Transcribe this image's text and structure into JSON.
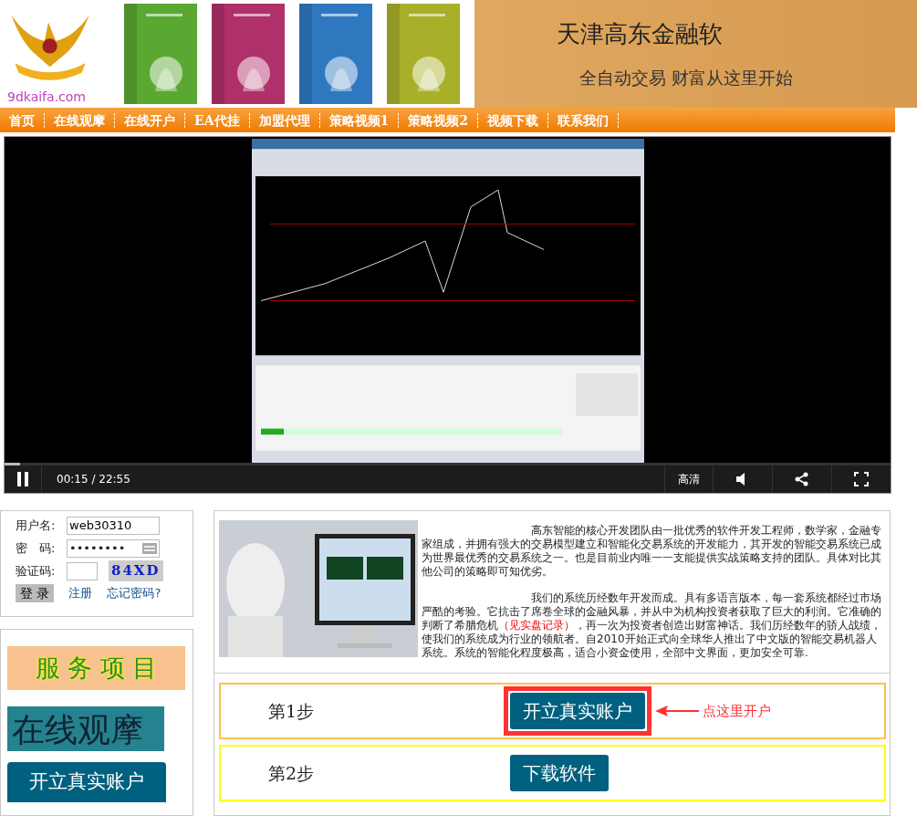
{
  "header": {
    "logo_text": "9dkaifa.com",
    "title": "天津高东金融软",
    "slogan": "全自动交易 财富从这里开始"
  },
  "nav": [
    "首页",
    "在线观摩",
    "在线开户",
    "EA代挂",
    "加盟代理",
    "策略视频1",
    "策略视频2",
    "视频下载",
    "联系我们"
  ],
  "video": {
    "time": "00:15 / 22:55",
    "quality": "高清",
    "level": 0.017
  },
  "login": {
    "fields": [
      {
        "label": "用户名:",
        "value": "web30310",
        "kind": "text"
      },
      {
        "label": "密　码:",
        "value": "••••••••",
        "kind": "password"
      },
      {
        "label": "验证码:",
        "kind": "captcha",
        "captcha": "84XD"
      }
    ],
    "submit": "登 录",
    "links": [
      "注册",
      "忘记密码?"
    ]
  },
  "services": {
    "title": "服 务 项 目",
    "buttons": [
      "在线观摩",
      "开立真实账户"
    ]
  },
  "intro": {
    "paragraphs": [
      "高东智能的核心开发团队由一批优秀的软件开发工程师，数学家，金融专家组成，并拥有强大的交易模型建立和智能化交易系统的开发能力，其开发的智能交易系统已成为世界最优秀的交易系统之一。也是目前业内唯一一支能提供实战策略支持的团队。具体对比其他公司的策略即可知优劣。",
      [
        "我们的系统历经数年开发而成。具有多语言版本，每一套系统都经过市场严酷的考验。它抗击了席卷全球的金融风暴，并从中为机构投资者获取了巨大的利润。它准确的判断了希腊危机",
        "（见实盘记录）",
        "，再一次为投资者创造出财富神话。我们历经数年的骄人战绩，使我们的系统成为行业的领航者。自2010开始正式向全球华人推出了中文版的智能交易机器人系统。系统的智能化程度极高，适合小资金使用，全部中文界面，更加安全可靠."
      ]
    ]
  },
  "steps": [
    {
      "label": "第1步",
      "button": "开立真实账户",
      "hint": "点这里开户",
      "highlighted": true
    },
    {
      "label": "第2步",
      "button": "下载软件",
      "highlighted": false
    }
  ]
}
